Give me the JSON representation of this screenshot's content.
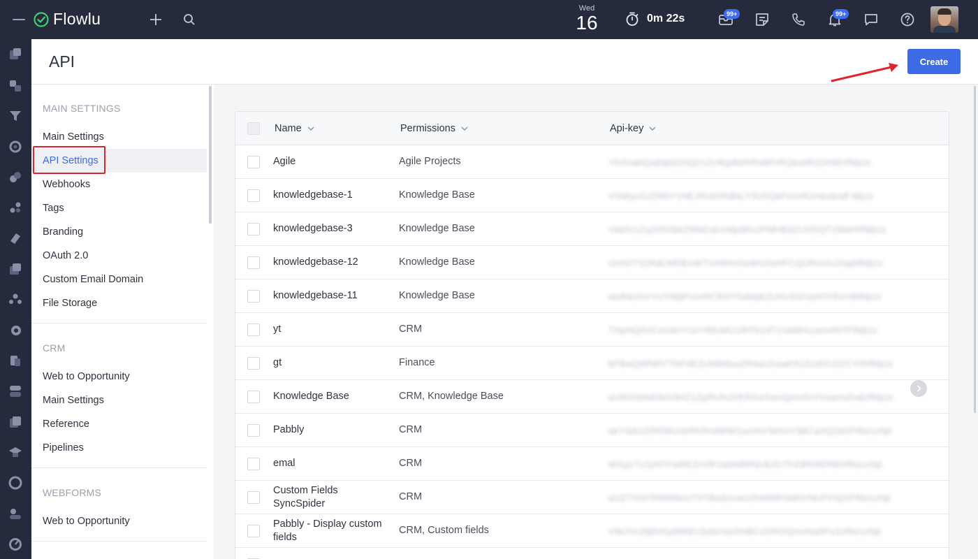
{
  "topbar": {
    "app_name": "Flowlu",
    "date_dow": "Wed",
    "date_day": "16",
    "timer": "0m 22s",
    "mail_badge": "99+",
    "notif_badge": "99+"
  },
  "page": {
    "title": "API",
    "create_label": "Create"
  },
  "settings_nav": {
    "sections": [
      {
        "title": "MAIN SETTINGS",
        "items": [
          "Main Settings",
          "API Settings",
          "Webhooks",
          "Tags",
          "Branding",
          "OAuth 2.0",
          "Custom Email Domain",
          "File Storage"
        ]
      },
      {
        "title": "CRM",
        "items": [
          "Web to Opportunity",
          "Main Settings",
          "Reference",
          "Pipelines"
        ]
      },
      {
        "title": "WEBFORMS",
        "items": [
          "Web to Opportunity"
        ]
      }
    ],
    "active_item": "API Settings"
  },
  "table": {
    "columns": [
      "Name",
      "Permissions",
      "Api-key"
    ],
    "rows": [
      {
        "name": "Agile",
        "permissions": "Agile Projects",
        "api_key": "Y0JUaklQajNjbDZtQ21ZcWg4b0hRaWVRQko0R21kWjVfMjUz"
      },
      {
        "name": "knowledgebase-1",
        "permissions": "Knowledge Base",
        "api_key": "VGMycGJZM0Y1NEJRck5RdktLY3U5QkFicnI4Umkxbndf MjUz"
      },
      {
        "name": "knowledgebase-3",
        "permissions": "Knowledge Base",
        "api_key": "Vkk0c1Zq205ObkZMbExkcHdpWUJPMHB3ZUVDQTZMdnRfMjUz"
      },
      {
        "name": "knowledgebase-12",
        "permissions": "Knowledge Base",
        "api_key": "UnhDT3ZRdUMDExWTU4Wmt2eWU2eHFCQURvUUJ2ajNfMjUz"
      },
      {
        "name": "knowledgebase-11",
        "permissions": "Knowledge Base",
        "api_key": "ekdhb1hVYUYMjlPUmRCRXY5aWpkZUhUSGVpNTFEeVBfMjUz"
      },
      {
        "name": "yt",
        "permissions": "CRM",
        "api_key": "THpNQ0VCeUdnYUvYREd4U1RlTk14T1VaMHczeni4NTFfMjUz"
      },
      {
        "name": "gt",
        "permissions": "Finance",
        "api_key": "bFBwQWNRYTNFdEZuNWdua2R4aU1waK81ZUdVU2ZCY0hfMjUz"
      },
      {
        "name": "Knowledge Base",
        "permissions": "CRM, Knowledge Base",
        "api_key": "aU9OSWdObG9HZ1ZpRUNJVERGeGwxQmo5cVVoamxDaEtfMjUz"
      },
      {
        "name": "Pabbly",
        "permissions": "CRM",
        "api_key": "akY3dUJ2RDBUckRKRndWW1ucnhVSkhoY3BCaXQ1bDFfNzczNjI"
      },
      {
        "name": "emal",
        "permissions": "CRM",
        "api_key": "WXg1TzJyNTFwREZvVlFza0tldWhjUEd1TFd3R09DNEhfNzczNjI"
      },
      {
        "name": "Custom Fields SyncSpider",
        "permissions": "CRM",
        "api_key": "aUZTSXFRMWtteUTSTBaSzcwU2h6WlRSM0VNUFFiQVFfNzczNjI"
      },
      {
        "name": "Pabbly - Display custom fields",
        "permissions": "CRM, Custom fields",
        "api_key": "VWJVc29jNXlydWtEc3ybUVpOHBCcDROQmxNa0Fic3JfNzczNjI"
      },
      {
        "name": "Check custom fields in",
        "permissions": "",
        "api_key": ""
      }
    ]
  },
  "colors": {
    "topbar_bg": "#262a3d",
    "accent": "#3d6be8",
    "highlight": "#e0242c",
    "logo_green": "#3ecf6e"
  }
}
